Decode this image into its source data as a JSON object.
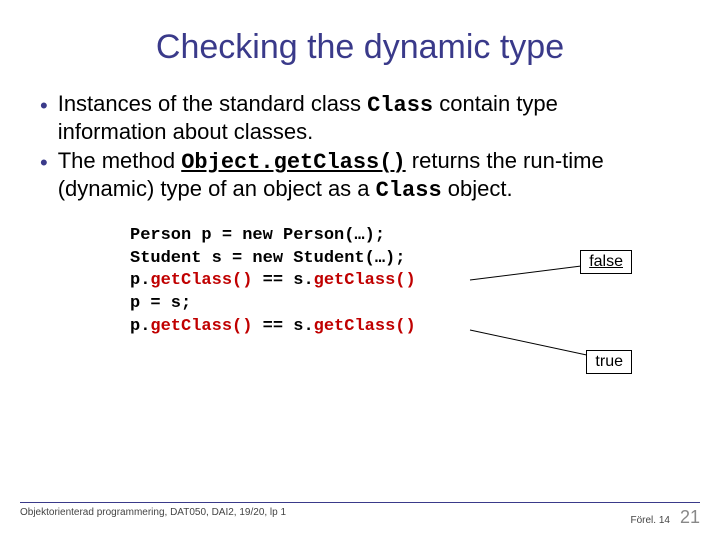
{
  "title": "Checking the dynamic type",
  "bullets": [
    {
      "pre": "Instances of the standard class ",
      "code": "Class",
      "post": " contain type information about classes."
    },
    {
      "pre": "The method ",
      "code": "Object.getClass()",
      "code_underline": true,
      "post": " returns the run-time (dynamic) type of an object as a ",
      "code2": "Class",
      "post2": " object."
    }
  ],
  "code": {
    "l1": "Person p = new Person(…);",
    "l2": "Student s = new Student(…);",
    "l3a": "p.",
    "l3b": "getClass()",
    "l3c": " == s.",
    "l3d": "getClass()",
    "l4": "p = s;",
    "l5a": "p.",
    "l5b": "getClass()",
    "l5c": " == s.",
    "l5d": "getClass()"
  },
  "callouts": {
    "false": "false",
    "true": "true"
  },
  "footer": {
    "left": "Objektorienterad programmering, DAT050, DAI2, 19/20, lp 1",
    "right": "Förel. 14",
    "page": "21"
  }
}
